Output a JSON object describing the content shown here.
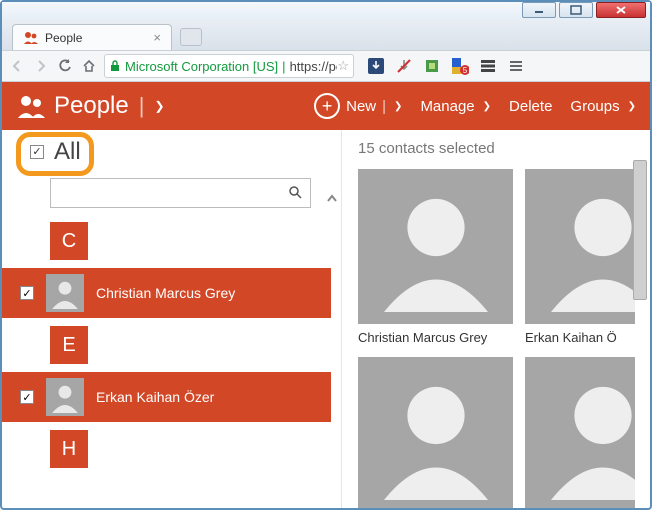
{
  "window": {
    "tab_title": "People"
  },
  "omnibox": {
    "ev_label": "Microsoft Corporation [US]",
    "url_prefix": "https://",
    "url_rest": "peop"
  },
  "appbar": {
    "title": "People",
    "new_label": "New",
    "manage_label": "Manage",
    "delete_label": "Delete",
    "groups_label": "Groups"
  },
  "left": {
    "all_label": "All",
    "search_placeholder": "",
    "letters": [
      "C",
      "E",
      "H"
    ],
    "contacts": [
      {
        "name": "Christian Marcus Grey"
      },
      {
        "name": "Erkan Kaihan Özer"
      }
    ]
  },
  "right": {
    "selected_text": "15 contacts selected",
    "cards": [
      {
        "name": "Christian Marcus Grey"
      },
      {
        "name": "Erkan Kaihan Ö"
      },
      {
        "name": ""
      },
      {
        "name": ""
      }
    ]
  }
}
